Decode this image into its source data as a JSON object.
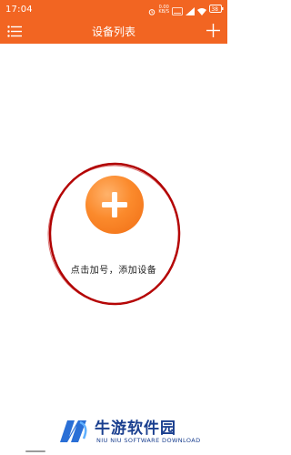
{
  "status_bar": {
    "time": "17:04",
    "speed_value": "0.00",
    "speed_unit": "KB/S",
    "battery": "38"
  },
  "app_bar": {
    "title": "设备列表",
    "menu_icon": "menu-icon",
    "add_icon": "plus-icon",
    "background_color": "#f26522"
  },
  "main": {
    "add_button_icon": "plus-icon",
    "hint_text": "点击加号，添加设备",
    "accent_color": "#fb8a2c",
    "highlight_ring_color": "#b00000"
  },
  "watermark": {
    "title": "牛游软件园",
    "subtitle": "NIU NIU SOFTWARE DOWNLOAD"
  }
}
